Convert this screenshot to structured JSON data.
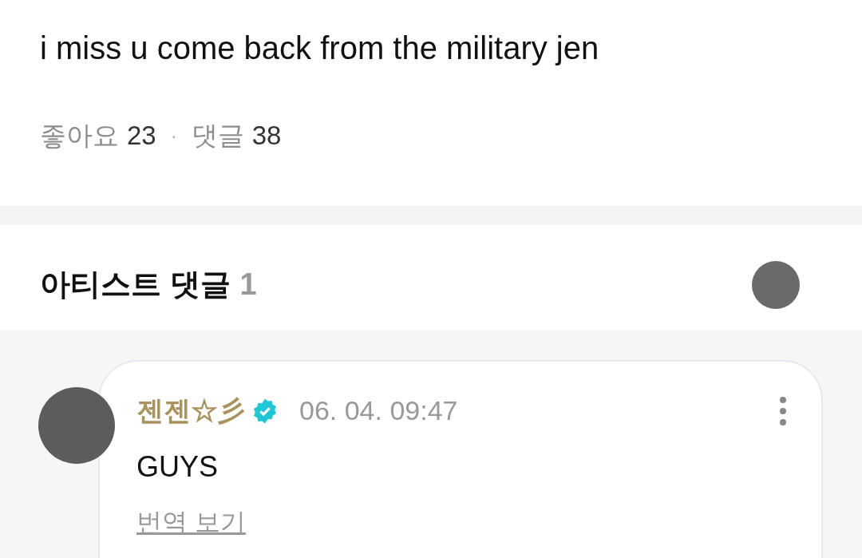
{
  "post": {
    "text": "i miss u come back from the military jen"
  },
  "stats": {
    "likes_label": "좋아요",
    "likes_count": "23",
    "separator": "·",
    "comments_label": "댓글",
    "comments_count": "38"
  },
  "artist_comments": {
    "title": "아티스트 댓글",
    "count": "1"
  },
  "comment": {
    "author": "젠젠☆彡",
    "verified": true,
    "time": "06. 04. 09:47",
    "text": "GUYS",
    "translate_link": "번역 보기"
  }
}
